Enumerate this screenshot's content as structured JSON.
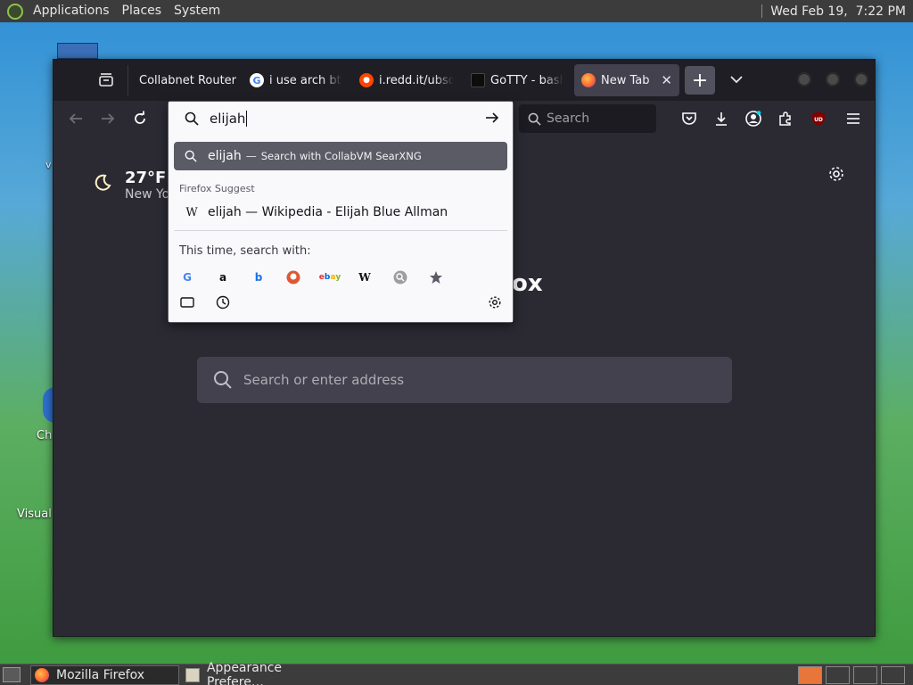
{
  "top_panel": {
    "menus": [
      "Applications",
      "Places",
      "System"
    ],
    "clock": "Wed Feb 19,  7:22 PM"
  },
  "desktop": {
    "icons": [
      {
        "label": "Ch"
      },
      {
        "label": "Visual"
      }
    ]
  },
  "browser": {
    "tabs": [
      {
        "label": "Collabnet Router",
        "favicon": "none",
        "active": false
      },
      {
        "label": "i use arch btw",
        "favicon": "google-icon",
        "active": false
      },
      {
        "label": "i.redd.it/ubsd",
        "favicon": "reddit-icon",
        "active": false
      },
      {
        "label": "GoTTY - bash",
        "favicon": "terminal-icon",
        "active": false
      },
      {
        "label": "New Tab",
        "favicon": "firefox-icon",
        "active": true
      }
    ],
    "toolbar": {
      "search_placeholder": "Search"
    },
    "urlbar": {
      "typed": "elijah",
      "selected_result": {
        "query": "elijah",
        "separator": "—",
        "action": "Search with CollabVM SearXNG"
      },
      "suggest_header": "Firefox Suggest",
      "suggestion": "elijah — Wikipedia - Elijah Blue Allman",
      "oneoff_header": "This time, search with:",
      "engines": [
        "google",
        "amazon",
        "bing",
        "duckduckgo",
        "ebay",
        "wikipedia",
        "searxng",
        "bookmarks",
        "tabs",
        "history"
      ]
    },
    "newtab": {
      "weather_temp": "27°F",
      "weather_city": "New Yo",
      "brand_fragment": "ox",
      "search_placeholder": "Search or enter address"
    }
  },
  "taskbar": {
    "tasks": [
      {
        "label": "Mozilla Firefox",
        "active": true
      },
      {
        "label": "Appearance Prefere…",
        "active": false
      }
    ]
  },
  "colors": {
    "firefox_bg": "#2b2a33",
    "tabbar_bg": "#1f1e25",
    "panel_bg": "#3c3c3c",
    "selected_result_bg": "#5b5b66"
  }
}
